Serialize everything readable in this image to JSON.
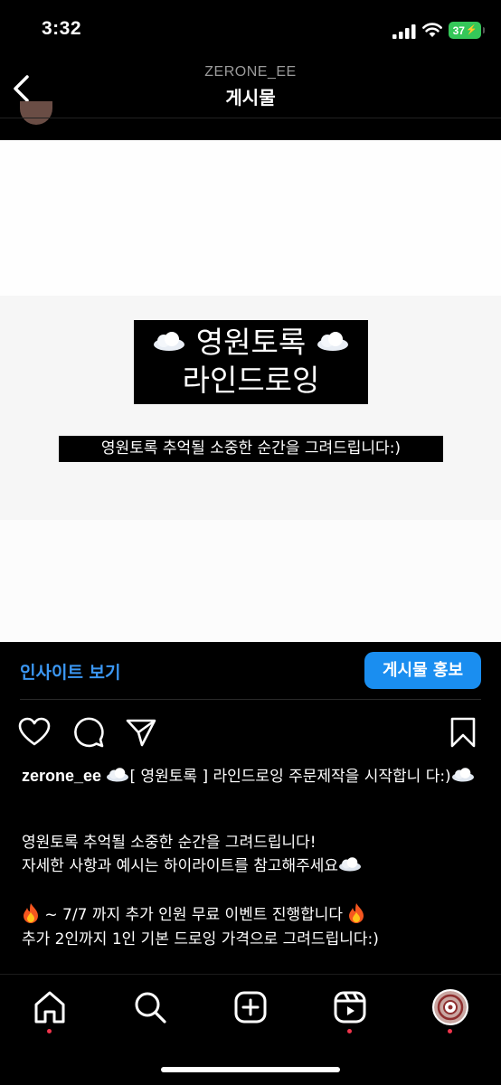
{
  "status_bar": {
    "time": "3:32",
    "battery": "37"
  },
  "header": {
    "username": "ZERONE_EE",
    "title": "게시물"
  },
  "post_image": {
    "title_line1": "영원토록",
    "title_line2": "라인드로잉",
    "subtitle": "영원토록 추억될 소중한 순간을 그려드립니다:)"
  },
  "insights": {
    "view_label": "인사이트 보기",
    "promote_label": "게시물 홍보"
  },
  "caption": {
    "username": "zerone_ee",
    "text_1": "[ 영원토록 ] 라인드로잉 주문제작을 시작합니",
    "text_1b": "다:)",
    "text_2": "영원토록 추억될 소중한 순간을 그려드립니다!",
    "text_3": "자세한 사항과 예시는 하이라이트를 참고해주세요",
    "text_4": "~ 7/7 까지 추가 인원 무료 이벤트 진행합니다",
    "text_5": "추가 2인까지 1인 기본 드로잉 가격으로 그려드립니다:)"
  },
  "icons": [
    "back-icon",
    "heart-icon",
    "comment-icon",
    "share-icon",
    "bookmark-icon",
    "home-icon",
    "search-icon",
    "create-icon",
    "reels-icon",
    "profile-avatar"
  ],
  "colors": {
    "accent": "#1a8ef0",
    "link": "#3b97f3",
    "notification": "#f0354c"
  }
}
